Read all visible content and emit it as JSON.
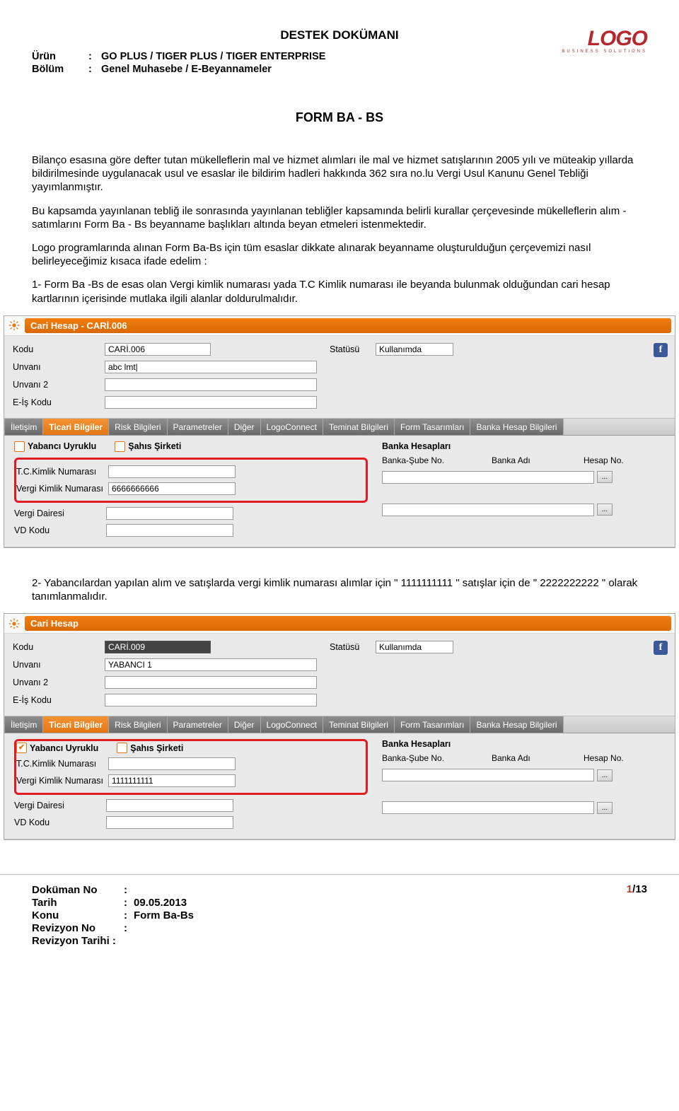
{
  "header": {
    "docTitle": "DESTEK DOKÜMANI",
    "urunLabel": "Ürün",
    "bolumLabel": "Bölüm",
    "colon": ":",
    "urun": "GO PLUS / TIGER PLUS / TIGER ENTERPRISE",
    "bolum": "Genel Muhasebe / E-Beyannameler",
    "logo": "LOGO",
    "logoSub": "BUSINESS SOLUTIONS"
  },
  "body": {
    "title": "FORM BA - BS",
    "p1": "Bilanço esasına göre defter tutan mükelleflerin mal ve hizmet alımları ile mal ve hizmet satışlarının 2005 yılı ve müteakip yıllarda bildirilmesinde uygulanacak usul ve esaslar ile bildirim hadleri hakkında 362 sıra no.lu Vergi Usul Kanunu Genel Tebliği yayımlanmıştır.",
    "p2": "Bu kapsamda yayınlanan tebliğ ile sonrasında yayınlanan tebliğler kapsamında belirli kurallar çerçevesinde mükelleflerin alım - satımlarını Form Ba - Bs beyanname başlıkları altında beyan etmeleri istenmektedir.",
    "p3": "Logo programlarında alınan Form Ba-Bs için tüm esaslar dikkate alınarak beyanname oluşturulduğun çerçevemizi nasıl belirleyeceğimiz kısaca ifade edelim :",
    "p4": "1- Form Ba -Bs de esas olan Vergi kimlik numarası yada T.C Kimlik numarası ile beyanda bulunmak olduğundan cari hesap kartlarının içerisinde mutlaka ilgili alanlar doldurulmalıdır.",
    "p5": "2- Yabancılardan yapılan alım ve satışlarda vergi kimlik numarası alımlar için \" 1111111111 \"  satışlar için de \" 2222222222 \" olarak tanımlanmalıdır."
  },
  "win1": {
    "title": "Cari Hesap - CARİ.006",
    "koduLabel": "Kodu",
    "kodu": "CARİ.006",
    "statusLabel": "Statüsü",
    "status": "Kullanımda",
    "unvaniLabel": "Unvanı",
    "unvani": "abc lmt|",
    "unvani2Label": "Unvanı 2",
    "eisLabel": "E-İş Kodu",
    "tabs": [
      "İletişim",
      "Ticari Bilgiler",
      "Risk Bilgileri",
      "Parametreler",
      "Diğer",
      "LogoConnect",
      "Teminat Bilgileri",
      "Form Tasarımları",
      "Banka Hesap Bilgileri"
    ],
    "yabanci": "Yabancı Uyruklu",
    "sahis": "Şahıs Şirketi",
    "tcLabel": "T.C.Kimlik Numarası",
    "vknLabel": "Vergi Kimlik Numarası",
    "vkn": "6666666666",
    "vdLabel": "Vergi Dairesi",
    "vdKoduLabel": "VD Kodu",
    "bankTitle": "Banka Hesapları",
    "bankHead1": "Banka-Şube No.",
    "bankHead2": "Banka Adı",
    "bankHead3": "Hesap No."
  },
  "win2": {
    "title": "Cari Hesap",
    "koduLabel": "Kodu",
    "kodu": "CARİ.009",
    "statusLabel": "Statüsü",
    "status": "Kullanımda",
    "unvaniLabel": "Unvanı",
    "unvani": "YABANCI 1",
    "unvani2Label": "Unvanı 2",
    "eisLabel": "E-İş Kodu",
    "tabs": [
      "İletişim",
      "Ticari Bilgiler",
      "Risk Bilgileri",
      "Parametreler",
      "Diğer",
      "LogoConnect",
      "Teminat Bilgileri",
      "Form Tasarımları",
      "Banka Hesap Bilgileri"
    ],
    "yabanci": "Yabancı Uyruklu",
    "sahis": "Şahıs Şirketi",
    "tcLabel": "T.C.Kimlik Numarası",
    "vknLabel": "Vergi Kimlik Numarası",
    "vkn": "1111111111",
    "vdLabel": "Vergi Dairesi",
    "vdKoduLabel": "VD Kodu",
    "bankTitle": "Banka Hesapları",
    "bankHead1": "Banka-Şube No.",
    "bankHead2": "Banka Adı",
    "bankHead3": "Hesap No."
  },
  "footer": {
    "dokNoLabel": "Doküman No",
    "tarihLabel": "Tarih",
    "tarih": "09.05.2013",
    "konuLabel": "Konu",
    "konu": "Form Ba-Bs",
    "revNoLabel": "Revizyon No",
    "revTarLabel": "Revizyon Tarihi :",
    "pageCur": "1",
    "pageSep": "/",
    "pageTot": "13"
  },
  "icons": {
    "ellipsis": "...",
    "info": "f"
  }
}
